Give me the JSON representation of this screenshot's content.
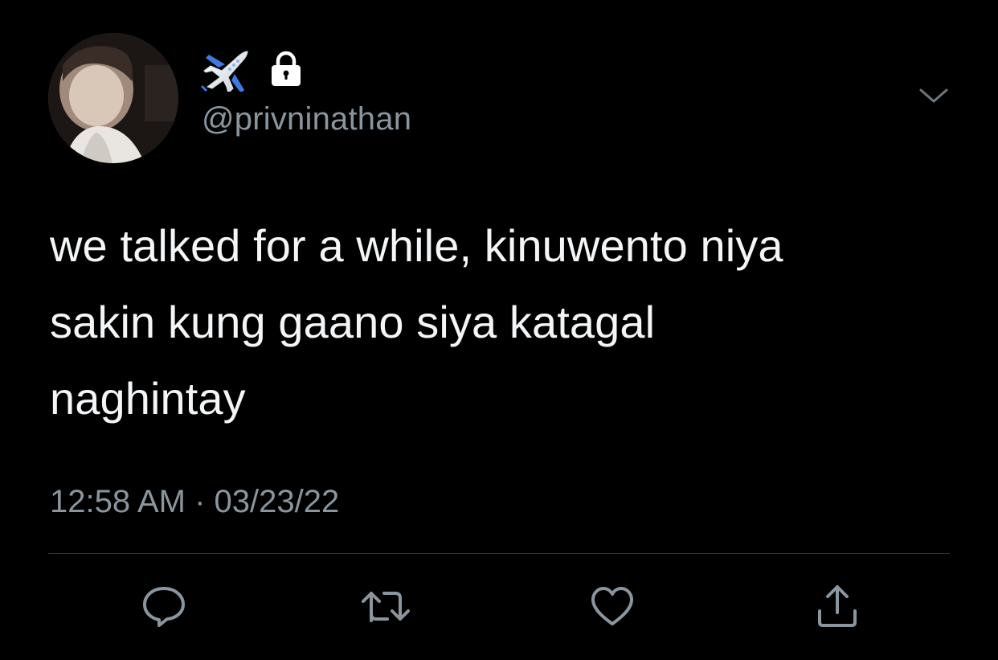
{
  "tweet": {
    "avatar_icon": "profile-photo",
    "display_name_icons": [
      "airplane-emoji",
      "lock-icon"
    ],
    "handle": "@privninathan",
    "text": "we talked for a while, kinuwento niya\nsakin kung gaano siya katagal\nnaghintay",
    "timestamp": "12:58 AM · 03/23/22",
    "menu_icon": "chevron-down-icon"
  },
  "actions": [
    {
      "name": "reply",
      "icon": "speech-bubble-icon"
    },
    {
      "name": "retweet",
      "icon": "retweet-icon"
    },
    {
      "name": "like",
      "icon": "heart-icon"
    },
    {
      "name": "share",
      "icon": "share-icon"
    }
  ],
  "colors": {
    "background": "#000000",
    "text": "#f3f5f7",
    "secondary": "#8b959e",
    "divider": "#2f3336",
    "icon": "#8b959e"
  }
}
